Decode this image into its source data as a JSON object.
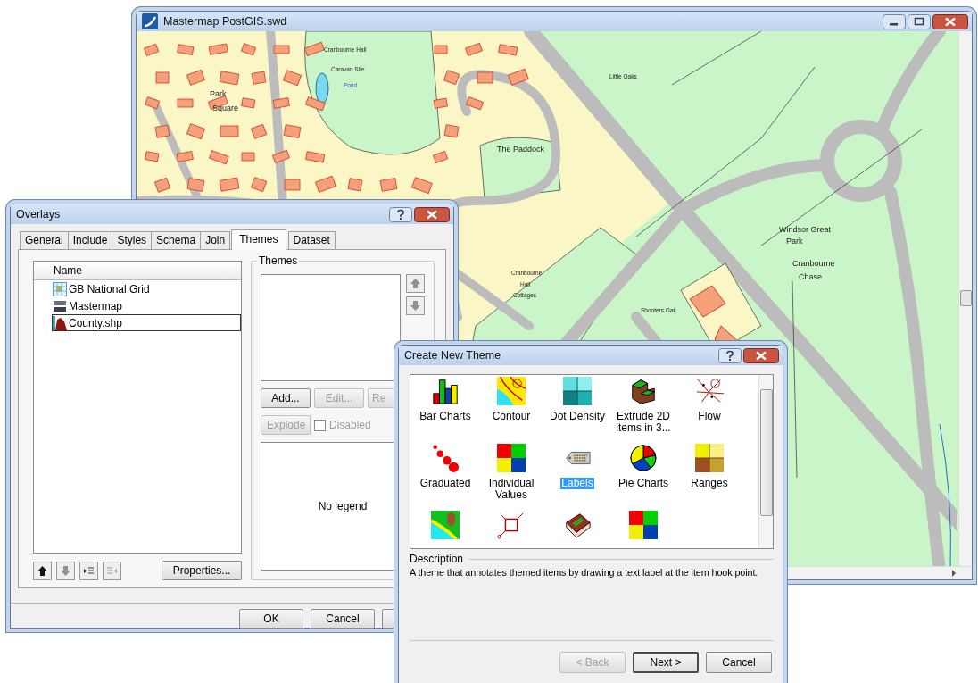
{
  "map_window": {
    "title": "Mastermap PostGIS.swd",
    "map_labels": [
      {
        "text": "Cranbourne Hall",
        "kind": "small"
      },
      {
        "text": "Caravan Site",
        "kind": "small"
      },
      {
        "text": "Little Oaks",
        "kind": "small"
      },
      {
        "text": "Pond",
        "kind": "water"
      },
      {
        "text": "Park",
        "kind": "large"
      },
      {
        "text": "Square",
        "kind": "large"
      },
      {
        "text": "The Paddock",
        "kind": "large"
      },
      {
        "text": "Windsor Great",
        "kind": "large"
      },
      {
        "text": "Park",
        "kind": "large"
      },
      {
        "text": "Cranbourne",
        "kind": "large"
      },
      {
        "text": "Cranbourne",
        "kind": "small"
      },
      {
        "text": "Chase",
        "kind": "large"
      },
      {
        "text": "Hall",
        "kind": "small"
      },
      {
        "text": "Cottages",
        "kind": "small"
      },
      {
        "text": "Shooters Oak",
        "kind": "small"
      }
    ]
  },
  "overlays": {
    "title": "Overlays",
    "tabs": [
      {
        "label": "General",
        "selected": false
      },
      {
        "label": "Include",
        "selected": false
      },
      {
        "label": "Styles",
        "selected": false
      },
      {
        "label": "Schema",
        "selected": false
      },
      {
        "label": "Join",
        "selected": false
      },
      {
        "label": "Themes",
        "selected": true
      },
      {
        "label": "Dataset",
        "selected": false
      }
    ],
    "list": {
      "column": "Name",
      "items": [
        {
          "name": "GB National Grid",
          "kind": "grid",
          "selected": false
        },
        {
          "name": "Mastermap",
          "kind": "postgis",
          "selected": false
        },
        {
          "name": "County.shp",
          "kind": "shape",
          "selected": true
        }
      ]
    },
    "themes_group": {
      "title": "Themes",
      "buttons": [
        {
          "label": "Add...",
          "disabled": false
        },
        {
          "label": "Edit...",
          "disabled": true
        },
        {
          "label": "Re",
          "disabled": true
        }
      ],
      "explode": {
        "label": "Explode",
        "disabled": true
      },
      "checkbox": {
        "label": "Disabled",
        "checked": false,
        "disabled": true
      },
      "legend": "No legend"
    },
    "properties_button": "Properties...",
    "buttons": [
      "OK",
      "Cancel"
    ]
  },
  "create_theme": {
    "title": "Create New Theme",
    "items": [
      {
        "label": "Bar Charts",
        "kind": "bar",
        "selected": false
      },
      {
        "label": "Contour",
        "kind": "contour",
        "selected": false
      },
      {
        "label": "Dot Density",
        "kind": "dots",
        "selected": false
      },
      {
        "label": "Extrude 2D items in 3...",
        "kind": "extrude",
        "selected": false
      },
      {
        "label": "Flow",
        "kind": "flow",
        "selected": false
      },
      {
        "label": "Graduated",
        "kind": "graduated",
        "selected": false
      },
      {
        "label": "Individual Values",
        "kind": "individual",
        "selected": false
      },
      {
        "label": "Labels",
        "kind": "labels",
        "selected": true
      },
      {
        "label": "Pie Charts",
        "kind": "pie",
        "selected": false
      },
      {
        "label": "Ranges",
        "kind": "ranges",
        "selected": false
      },
      {
        "kind": "relief",
        "selected": false
      },
      {
        "kind": "topology",
        "selected": false
      },
      {
        "kind": "saved",
        "selected": false
      },
      {
        "kind": "feature",
        "selected": false
      }
    ],
    "description_label": "Description",
    "description": "A theme that annotates themed items by drawing a text label at the item hook point.",
    "buttons": [
      {
        "label": "< Back",
        "disabled": true,
        "default": false
      },
      {
        "label": "Next >",
        "disabled": false,
        "default": true
      },
      {
        "label": "Cancel",
        "disabled": false,
        "default": false
      }
    ]
  }
}
